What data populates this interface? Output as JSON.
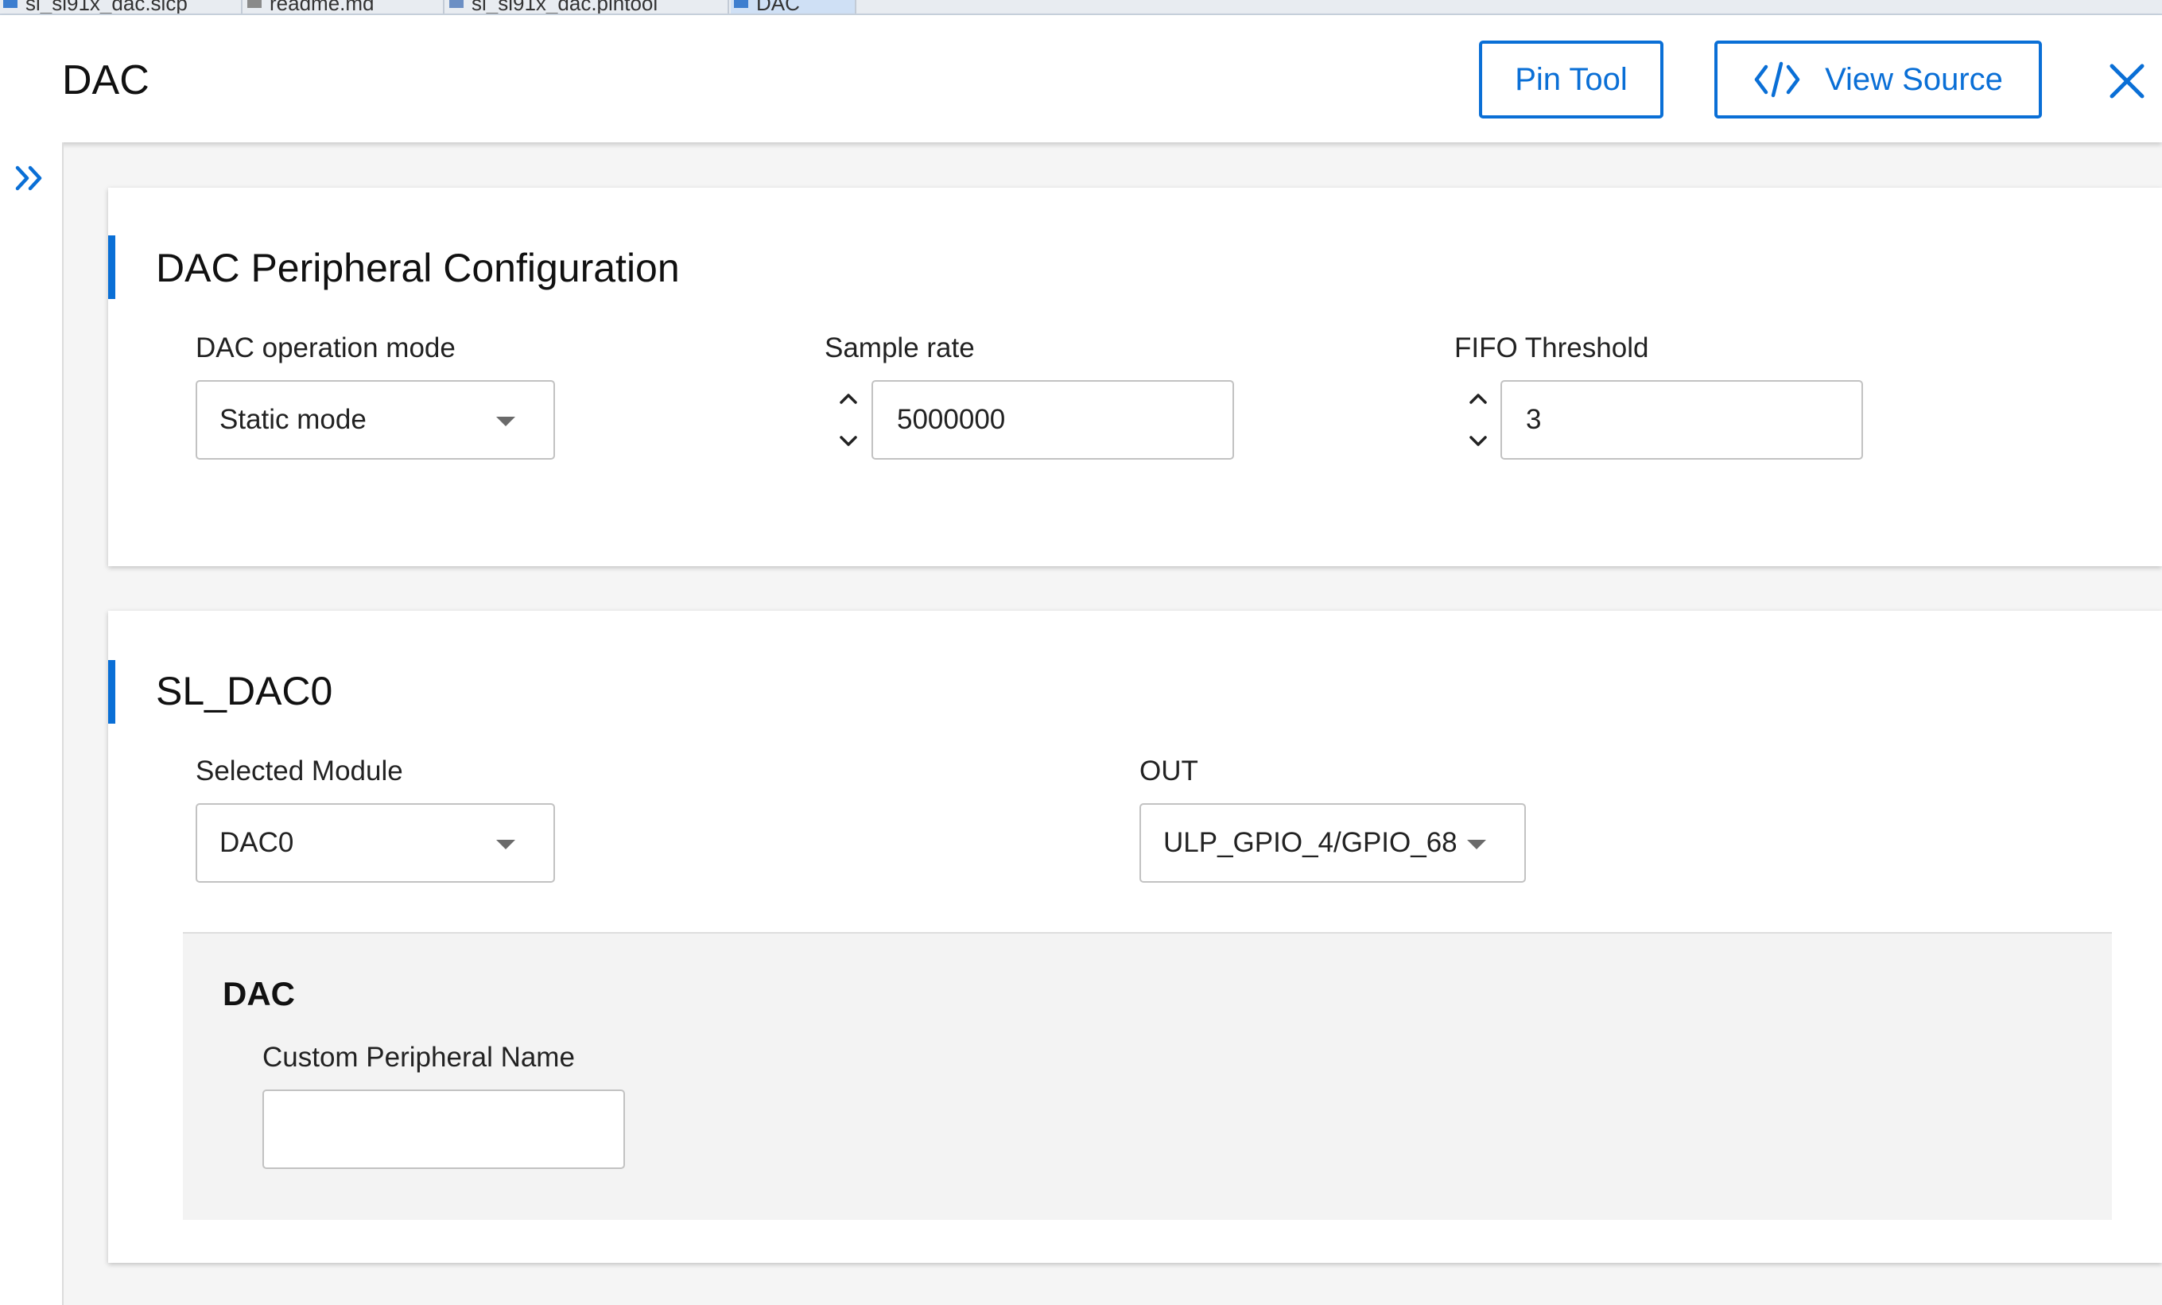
{
  "tabs": [
    {
      "label": "sl_si91x_dac.slcp",
      "active": false
    },
    {
      "label": "readme.md",
      "active": false
    },
    {
      "label": "sl_si91x_dac.pintool",
      "active": false
    },
    {
      "label": "DAC",
      "active": true
    }
  ],
  "header": {
    "title": "DAC",
    "pin_tool_label": "Pin Tool",
    "view_source_label": "View Source",
    "close_icon": "close-icon",
    "code_icon": "code-brackets-icon"
  },
  "sidebar": {
    "expand_icon": "double-chevron-right-icon"
  },
  "peripheral_config": {
    "title": "DAC Peripheral Configuration",
    "operation_mode": {
      "label": "DAC operation mode",
      "value": "Static mode"
    },
    "sample_rate": {
      "label": "Sample rate",
      "value": "5000000"
    },
    "fifo_threshold": {
      "label": "FIFO Threshold",
      "value": "3"
    }
  },
  "instance": {
    "title": "SL_DAC0",
    "selected_module": {
      "label": "Selected Module",
      "value": "DAC0"
    },
    "out": {
      "label": "OUT",
      "value": "ULP_GPIO_4/GPIO_68"
    },
    "dac_section": {
      "title": "DAC",
      "custom_name": {
        "label": "Custom Peripheral Name",
        "value": ""
      }
    }
  },
  "colors": {
    "accent": "#0a6fd6",
    "background": "#f5f5f5",
    "card": "#ffffff",
    "subpanel": "#f3f3f3"
  }
}
